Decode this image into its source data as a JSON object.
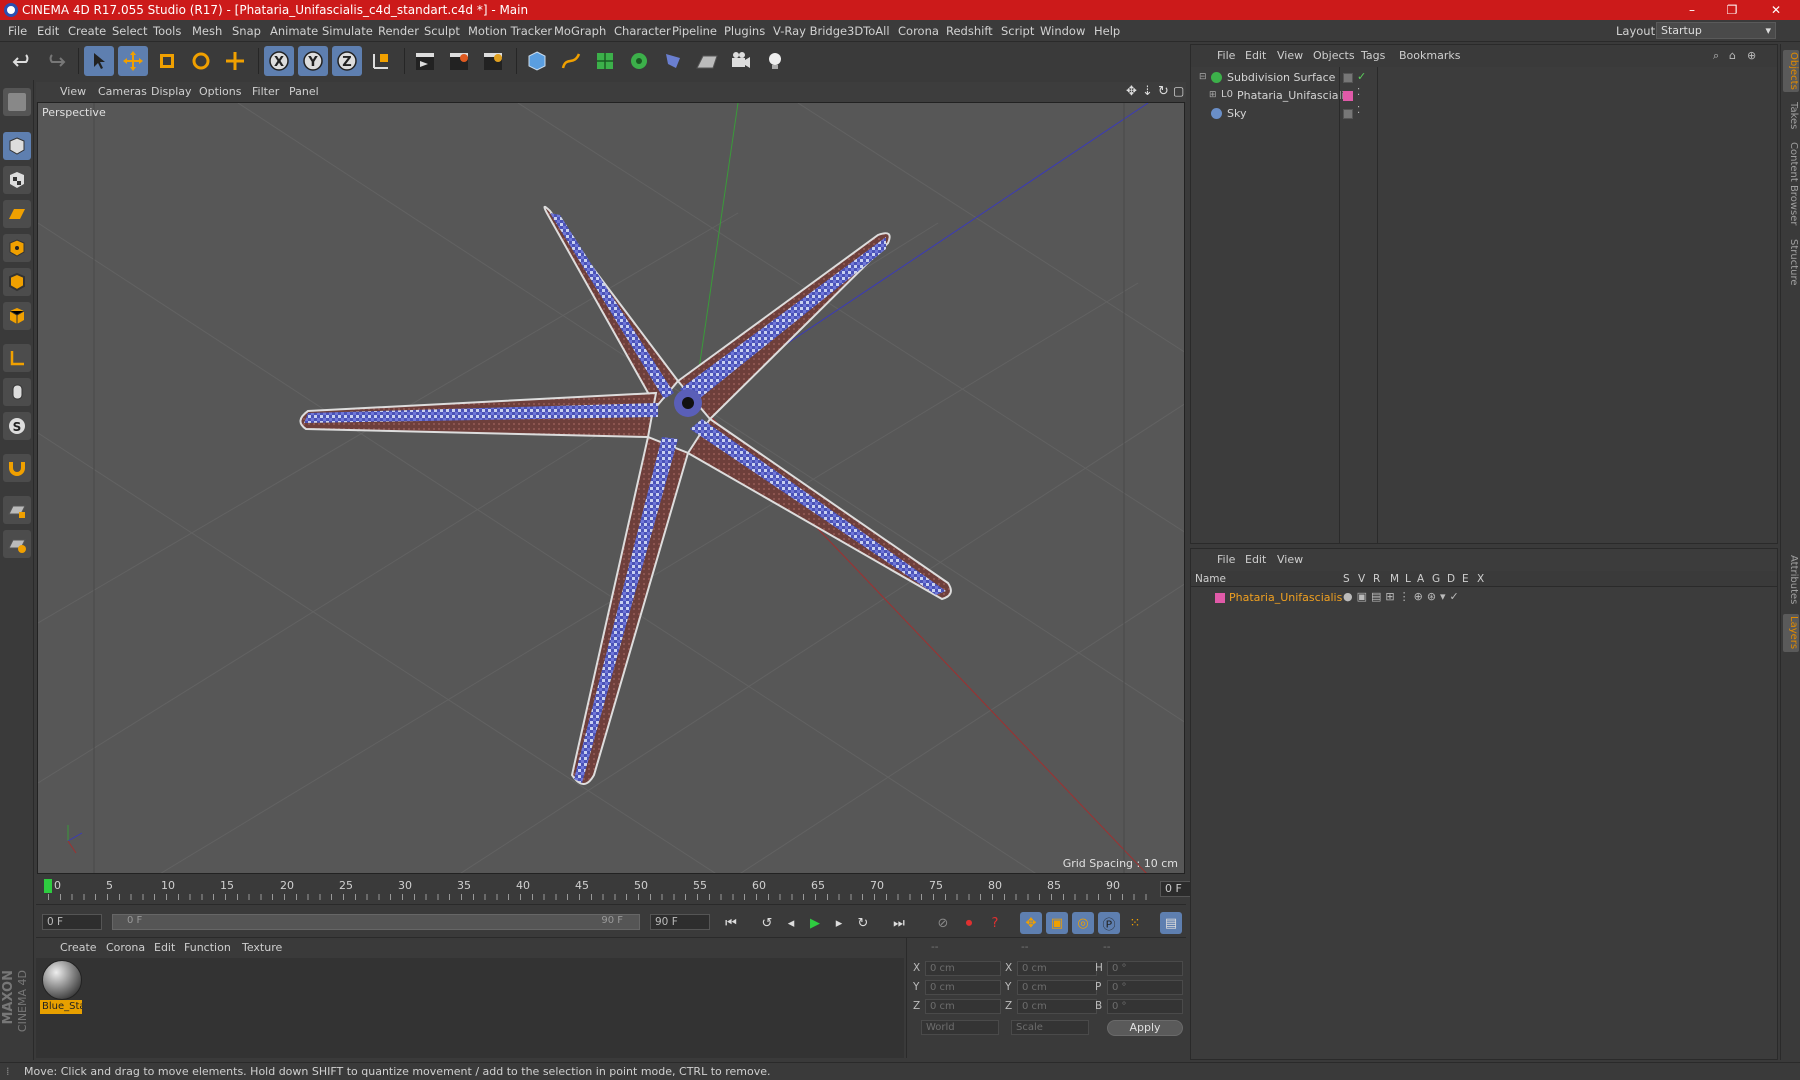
{
  "window": {
    "title": "CINEMA 4D R17.055 Studio (R17) - [Phataria_Unifascialis_c4d_standart.c4d *] - Main",
    "controls": [
      "–",
      "❐",
      "✕"
    ]
  },
  "menubar": {
    "items": [
      "File",
      "Edit",
      "Create",
      "Select",
      "Tools",
      "Mesh",
      "Snap",
      "Animate",
      "Simulate",
      "Render",
      "Sculpt",
      "Motion Tracker",
      "MoGraph",
      "Character",
      "Pipeline",
      "Plugins",
      "V-Ray Bridge",
      "3DToAll",
      "Corona",
      "Redshift",
      "Script",
      "Window",
      "Help"
    ],
    "layout_label": "Layout:",
    "layout_value": "Startup"
  },
  "viewport": {
    "menu": [
      "View",
      "Cameras",
      "Display",
      "Options",
      "Filter",
      "Panel"
    ],
    "camera_label": "Perspective",
    "grid_spacing": "Grid Spacing : 10 cm"
  },
  "timeline": {
    "ticks": [
      "0",
      "5",
      "10",
      "15",
      "20",
      "25",
      "30",
      "35",
      "40",
      "45",
      "50",
      "55",
      "60",
      "65",
      "70",
      "75",
      "80",
      "85",
      "90"
    ],
    "current_frame": "0 F"
  },
  "playback": {
    "start_field": "0 F",
    "range_start": "0 F",
    "range_end": "90 F",
    "end_field": "90 F"
  },
  "material_manager": {
    "menu": [
      "Create",
      "Corona",
      "Edit",
      "Function",
      "Texture"
    ],
    "materials": [
      {
        "name": "Blue_Sta"
      }
    ]
  },
  "coordinates": {
    "headers": [
      "--",
      "--",
      "--"
    ],
    "rows": [
      {
        "a_label": "X",
        "a_val": "0 cm",
        "b_label": "X",
        "b_val": "0 cm",
        "c_label": "H",
        "c_val": "0 °"
      },
      {
        "a_label": "Y",
        "a_val": "0 cm",
        "b_label": "Y",
        "b_val": "0 cm",
        "c_label": "P",
        "c_val": "0 °"
      },
      {
        "a_label": "Z",
        "a_val": "0 cm",
        "b_label": "Z",
        "b_val": "0 cm",
        "c_label": "B",
        "c_val": "0 °"
      }
    ],
    "mode_world": "World",
    "mode_scale": "Scale",
    "apply_label": "Apply"
  },
  "object_manager": {
    "menu": [
      "File",
      "Edit",
      "View",
      "Objects",
      "Tags",
      "Bookmarks"
    ],
    "objects": [
      {
        "name": "Subdivision Surface",
        "tag_color": "#3cb04a"
      },
      {
        "name": "Phataria_Unifascialis",
        "tag_color": "#e05aa8"
      },
      {
        "name": "Sky",
        "tag_color": "#6a8fc8"
      }
    ]
  },
  "layer_manager": {
    "menu": [
      "File",
      "Edit",
      "View"
    ],
    "columns": [
      "Name",
      "S",
      "V",
      "R",
      "M",
      "L",
      "A",
      "G",
      "D",
      "E",
      "X"
    ],
    "layers": [
      {
        "name": "Phataria_Unifascialis",
        "color": "#e05aa8"
      }
    ]
  },
  "right_tabs": [
    "Objects",
    "Takes",
    "Content Browser",
    "Structure",
    "Attributes",
    "Layers"
  ],
  "branding": {
    "line1": "MAXON",
    "line2": "CINEMA 4D"
  },
  "status": {
    "text": "Move: Click and drag to move elements. Hold down SHIFT to quantize movement / add to the selection in point mode, CTRL to remove."
  },
  "colors": {
    "title_bar": "#cc1a1a",
    "accent_active": "#5e7fb0",
    "selected_orange": "#e8a000",
    "layer_name": "#f0a020"
  }
}
